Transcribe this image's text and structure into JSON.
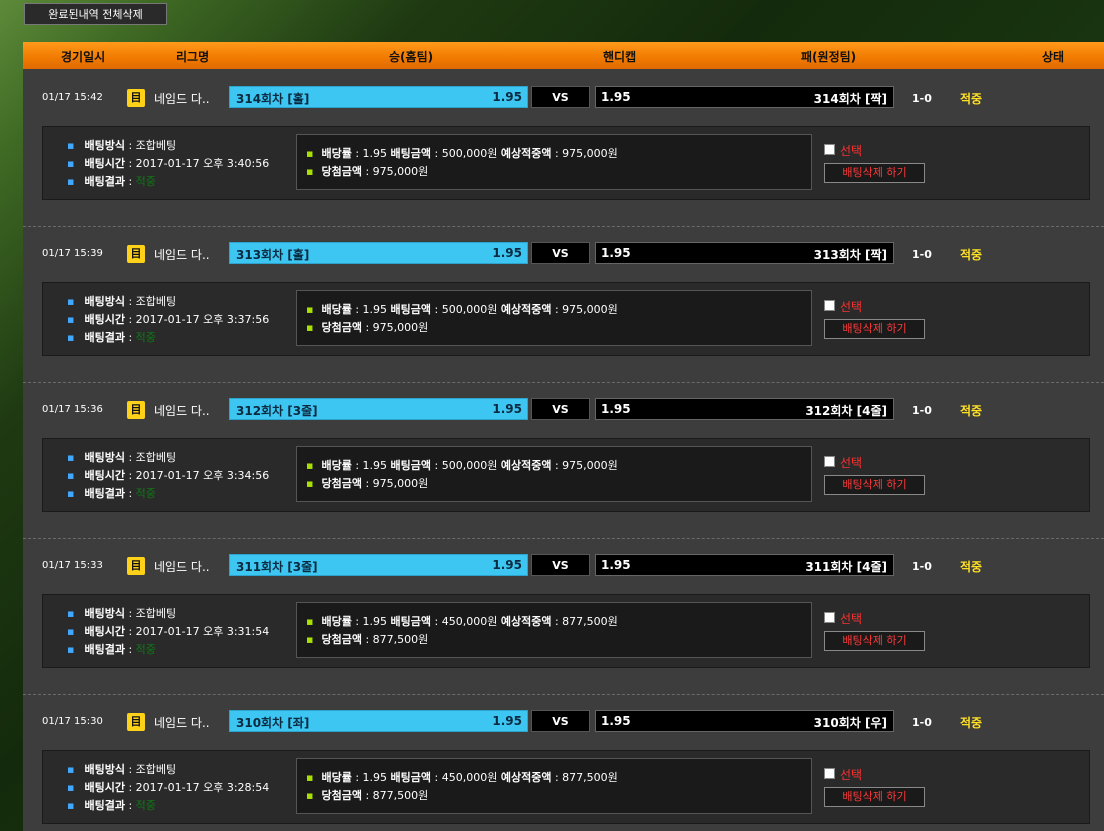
{
  "top_button": "완료된내역 전체삭제",
  "header": {
    "time": "경기일시",
    "league": "리그명",
    "home": "승(홈팀)",
    "handicap": "핸디캡",
    "away": "패(원정팀)",
    "status": "상태"
  },
  "labels": {
    "method": "배팅방식",
    "bet_time": "배팅시간",
    "result": "배팅결과",
    "rate": "배당률",
    "amount": "배팅금액",
    "expected": "예상적중액",
    "win": "당첨금액",
    "select": "선택",
    "delete": "배팅삭제 하기",
    "vs": "VS",
    "icon_char": "目"
  },
  "bets": [
    {
      "time": "01/17 15:42",
      "league": "네임드 다..",
      "home_team": "314회차 [홀]",
      "home_odds": "1.95",
      "away_odds": "1.95",
      "away_team": "314회차 [짝]",
      "score": "1-0",
      "status": "적중",
      "method": "조합베팅",
      "bet_time": "2017-01-17 오후 3:40:56",
      "result": "적중",
      "rate": "1.95",
      "amount": "500,000원",
      "expected": "975,000원",
      "win": "975,000원"
    },
    {
      "time": "01/17 15:39",
      "league": "네임드 다..",
      "home_team": "313회차 [홀]",
      "home_odds": "1.95",
      "away_odds": "1.95",
      "away_team": "313회차 [짝]",
      "score": "1-0",
      "status": "적중",
      "method": "조합베팅",
      "bet_time": "2017-01-17 오후 3:37:56",
      "result": "적중",
      "rate": "1.95",
      "amount": "500,000원",
      "expected": "975,000원",
      "win": "975,000원"
    },
    {
      "time": "01/17 15:36",
      "league": "네임드 다..",
      "home_team": "312회차 [3줄]",
      "home_odds": "1.95",
      "away_odds": "1.95",
      "away_team": "312회차 [4줄]",
      "score": "1-0",
      "status": "적중",
      "method": "조합베팅",
      "bet_time": "2017-01-17 오후 3:34:56",
      "result": "적중",
      "rate": "1.95",
      "amount": "500,000원",
      "expected": "975,000원",
      "win": "975,000원"
    },
    {
      "time": "01/17 15:33",
      "league": "네임드 다..",
      "home_team": "311회차 [3줄]",
      "home_odds": "1.95",
      "away_odds": "1.95",
      "away_team": "311회차 [4줄]",
      "score": "1-0",
      "status": "적중",
      "method": "조합베팅",
      "bet_time": "2017-01-17 오후 3:31:54",
      "result": "적중",
      "rate": "1.95",
      "amount": "450,000원",
      "expected": "877,500원",
      "win": "877,500원"
    },
    {
      "time": "01/17 15:30",
      "league": "네임드 다..",
      "home_team": "310회차 [좌]",
      "home_odds": "1.95",
      "away_odds": "1.95",
      "away_team": "310회차 [우]",
      "score": "1-0",
      "status": "적중",
      "method": "조합베팅",
      "bet_time": "2017-01-17 오후 3:28:54",
      "result": "적중",
      "rate": "1.95",
      "amount": "450,000원",
      "expected": "877,500원",
      "win": "877,500원"
    }
  ],
  "colors": {
    "header_orange": "#f07a00",
    "home_blue": "#3ec6f2",
    "status_yellow": "#ffe022",
    "delete_red": "#ff3a3a"
  }
}
